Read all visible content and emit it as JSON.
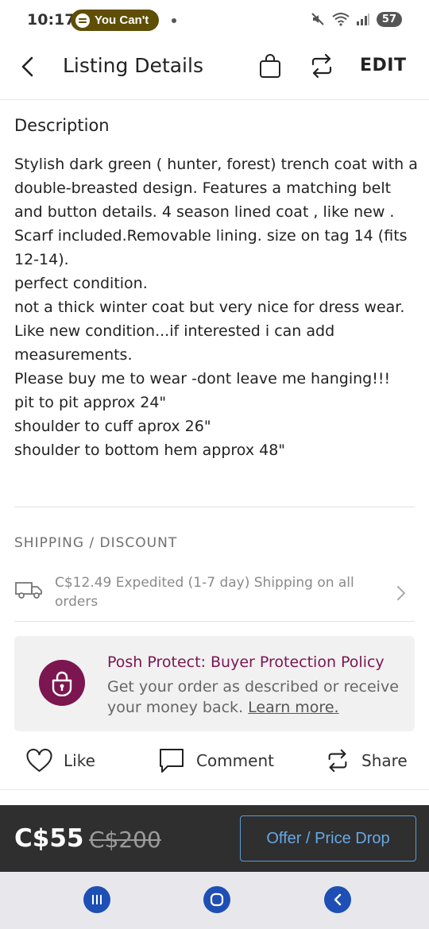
{
  "status_bar": {
    "time": "10:17",
    "media_label": "You Can't",
    "battery": "57"
  },
  "header": {
    "title": "Listing Details",
    "edit_label": "EDIT"
  },
  "description": {
    "heading": "Description",
    "body": "Stylish dark green ( hunter, forest) trench coat with a double-breasted design. Features a matching belt and button details. 4 season lined coat , like new . Scarf included.Removable lining. size on tag 14 (fits 12-14).\nperfect condition.\nnot a thick winter coat but very nice for dress wear.\nLike new condition...if interested i can add measurements.\nPlease buy me to wear -dont leave me hanging!!!\npit to pit approx 24\"\nshoulder to cuff aprox 26\"\nshoulder to bottom hem approx 48\""
  },
  "shipping": {
    "heading": "SHIPPING / DISCOUNT",
    "text": "C$12.49 Expedited (1-7 day) Shipping on all orders"
  },
  "protect": {
    "title": "Posh Protect: Buyer Protection Policy",
    "text": "Get your order as described or receive your money back.",
    "link": "Learn more."
  },
  "actions": {
    "like": "Like",
    "comment": "Comment",
    "share": "Share"
  },
  "price_bar": {
    "price": "C$55",
    "original_price": "C$200",
    "offer_label": "Offer / Price Drop"
  },
  "colors": {
    "accent": "#7b1651",
    "offer_blue": "#66a8e6",
    "price_bar_bg": "#2f2f2f"
  }
}
